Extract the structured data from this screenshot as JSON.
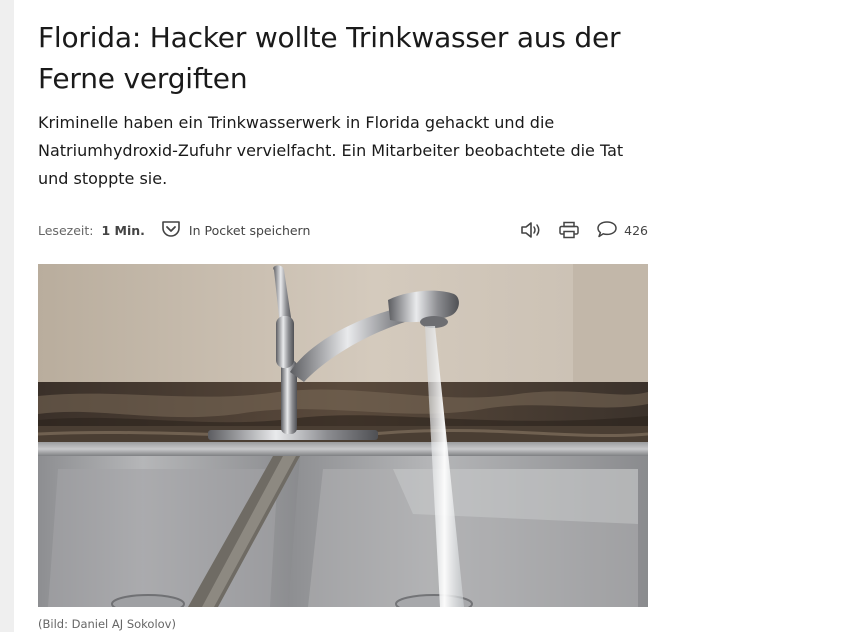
{
  "article": {
    "headline": "Florida: Hacker wollte Trinkwasser aus der Ferne vergiften",
    "lead": "Kriminelle haben ein Trinkwasserwerk in Florida gehackt und die Natriumhydroxid-Zufuhr vervielfacht. Ein Mitarbeiter beobachtete die Tat und stoppte sie."
  },
  "meta": {
    "reading_time_label": "Lesezeit:",
    "reading_time_value": "1 Min.",
    "pocket_label": "In Pocket speichern",
    "comment_count": "426",
    "icons": [
      "pocket-icon",
      "audio-speaker-icon",
      "print-icon",
      "comment-bubble-icon"
    ]
  },
  "figure": {
    "caption": "(Bild: Daniel AJ Sokolov)"
  },
  "colors": {
    "text": "#1a1a1a",
    "meta_text": "#555555",
    "rail": "#efefef"
  }
}
